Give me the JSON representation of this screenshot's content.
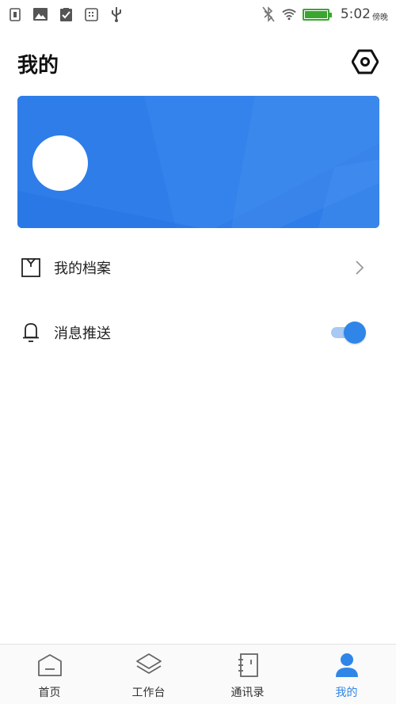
{
  "status_bar": {
    "time": "5:02",
    "time_suffix": "傍晚",
    "battery_level": 1.0,
    "icons": [
      "sim-icon",
      "image-icon",
      "clipboard-check-icon",
      "sd-card-icon",
      "usb-icon",
      "bluetooth-off-icon",
      "wifi-icon",
      "battery-icon"
    ]
  },
  "header": {
    "title": "我的",
    "settings_icon": "gear-hex-icon"
  },
  "profile_card": {
    "background_color": "#2f7fe9"
  },
  "menu": {
    "archive": {
      "label": "我的档案",
      "icon": "shirt-icon"
    },
    "push": {
      "label": "消息推送",
      "icon": "bell-icon",
      "enabled": true
    }
  },
  "bottom_nav": {
    "items": [
      {
        "label": "首页",
        "icon": "home-icon",
        "active": false
      },
      {
        "label": "工作台",
        "icon": "layers-icon",
        "active": false
      },
      {
        "label": "通讯录",
        "icon": "contacts-icon",
        "active": false
      },
      {
        "label": "我的",
        "icon": "person-icon",
        "active": true
      }
    ]
  },
  "colors": {
    "accent": "#2f86e8",
    "battery": "#3aa62f"
  }
}
